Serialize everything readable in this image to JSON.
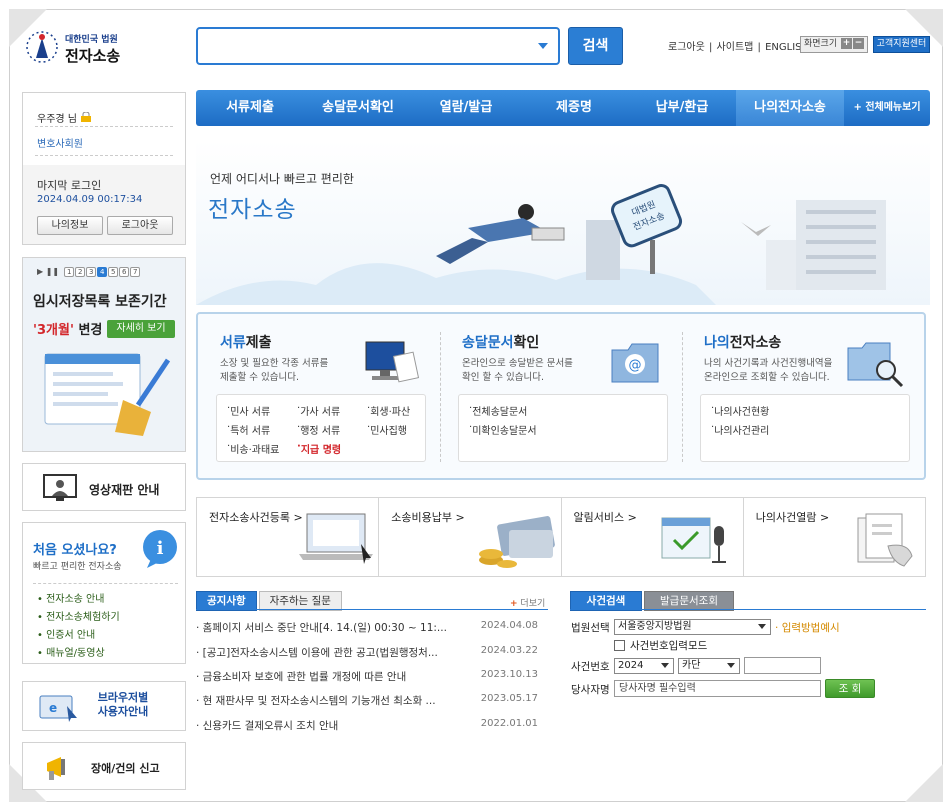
{
  "header": {
    "logo_sub": "대한민국 법원",
    "logo_main": "전자소송",
    "search_button": "검색",
    "links": [
      "로그아웃",
      "사이트맵",
      "ENGLISH"
    ],
    "font_size_label": "화면크기",
    "font_plus": "+",
    "font_minus": "−",
    "support_button": "고객지원센터"
  },
  "nav": {
    "items": [
      "서류제출",
      "송달문서확인",
      "열람/발급",
      "제증명",
      "납부/환급",
      "나의전자소송"
    ],
    "all_menu": "+ 전체메뉴보기"
  },
  "login": {
    "user": "우주경 님",
    "group": "변호사회원",
    "last_login_label": "마지막 로그인",
    "last_login_time": "2024.04.09 00:17:34",
    "myinfo_button": "나의정보",
    "logout_button": "로그아웃"
  },
  "banner": {
    "pages": [
      "1",
      "2",
      "3",
      "4",
      "5",
      "6",
      "7"
    ],
    "title": "임시저장목록 보존기간",
    "highlight": "'3개월'",
    "change": "변경",
    "more": "자세히 보기"
  },
  "side": {
    "video": "영상재판 안내",
    "first_title": "처음 오셨나요?",
    "first_sub": "빠르고 편리한 전자소송",
    "first_links": [
      "전자소송 안내",
      "전자소송체험하기",
      "인증서 안내",
      "매뉴얼/동영상"
    ],
    "browser_1": "브라우저별",
    "browser_2": "사용자안내",
    "report": "장애/건의 신고"
  },
  "hero": {
    "slogan": "언제 어디서나 빠르고 편리한",
    "brand": "전자소송",
    "sign_1": "대법원",
    "sign_2": "전자소송"
  },
  "services": [
    {
      "title_em": "서류",
      "title_rest": "제출",
      "desc_1": "소장 및 필요한 각종 서류를",
      "desc_2": "제출할 수 있습니다.",
      "items": [
        "민사 서류",
        "가사 서류",
        "회생·파산",
        "특허 서류",
        "행정 서류",
        "민사집행",
        "비송·과태료",
        "지급 명령"
      ]
    },
    {
      "title_em": "송달문서",
      "title_rest": "확인",
      "desc_1": "온라인으로 송달받은 문서를",
      "desc_2": "확인 할 수 있습니다.",
      "items": [
        "전체송달문서",
        "미확인송달문서"
      ]
    },
    {
      "title_em": "나의",
      "title_rest": "전자소송",
      "desc_1": "나의 사건기록과 사건진행내역을",
      "desc_2": "온라인으로 조회할 수 있습니다.",
      "items": [
        "나의사건현황",
        "나의사건관리"
      ]
    }
  ],
  "quick": [
    "전자소송사건등록 >",
    "소송비용납부 >",
    "알림서비스 >",
    "나의사건열람 >"
  ],
  "notice": {
    "tabs": [
      "공지사항",
      "자주하는 질문"
    ],
    "more": "더보기",
    "rows": [
      {
        "title": "· 홈페이지 서비스 중단 안내[4. 14.(일) 00:30 ~ 11:...",
        "date": "2024.04.08"
      },
      {
        "title": "· [공고]전자소송시스템 이용에 관한 공고(법원행정처...",
        "date": "2024.03.22"
      },
      {
        "title": "· 금융소비자 보호에 관한 법률 개정에 따른 안내",
        "date": "2023.10.13"
      },
      {
        "title": "· 현 재판사무 및 전자소송시스템의 기능개선 최소화 ...",
        "date": "2023.05.17"
      },
      {
        "title": "· 신용카드 결제오류시 조치 안내",
        "date": "2022.01.01"
      }
    ]
  },
  "case": {
    "tabs": [
      "사건검색",
      "발급문서조회"
    ],
    "court_label": "법원선택",
    "court_value": "서울중앙지방법원",
    "example_link": "입력방법예시",
    "manual_mode": "사건번호입력모드",
    "number_label": "사건번호",
    "year_value": "2024",
    "kind_value": "카단",
    "party_label": "당사자명",
    "party_placeholder": "당사자명 필수입력",
    "search_button": "조 회"
  },
  "colors": {
    "accent": "#2a7bd3",
    "nav": "#1d6cc4",
    "green": "#4aa23a",
    "red": "#d3262b"
  }
}
